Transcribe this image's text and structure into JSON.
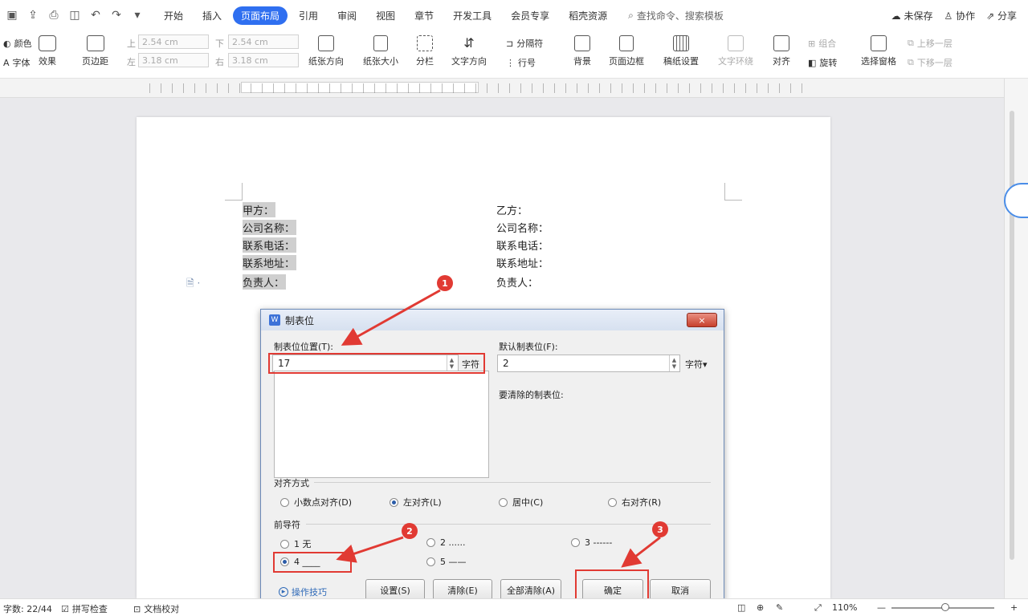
{
  "quick_access": [
    "save-icon",
    "export-icon",
    "print-icon",
    "preview-icon",
    "undo-icon",
    "redo-icon",
    "more-icon"
  ],
  "menu": {
    "tabs": [
      "开始",
      "插入",
      "页面布局",
      "引用",
      "审阅",
      "视图",
      "章节",
      "开发工具",
      "会员专享",
      "稻壳资源"
    ],
    "active_tab": "页面布局",
    "search": "查找命令、搜索模板"
  },
  "top_right": {
    "save_status": "未保存",
    "collab": "协作",
    "share": "分享"
  },
  "ribbon": {
    "color": "颜色",
    "font": "字体",
    "effects": "效果",
    "margins": "页边距",
    "top_label": "上",
    "top_value": "2.54 cm",
    "bottom_label": "下",
    "bottom_value": "2.54 cm",
    "left_label": "左",
    "left_value": "3.18 cm",
    "right_label": "右",
    "right_value": "3.18 cm",
    "orientation": "纸张方向",
    "size": "纸张大小",
    "columns": "分栏",
    "text_direction": "文字方向",
    "breaks": "分隔符",
    "line_numbers": "行号",
    "background": "背景",
    "page_border": "页面边框",
    "paper_setup": "稿纸设置",
    "text_wrap": "文字环绕",
    "align": "对齐",
    "group": "组合",
    "rotate": "旋转",
    "selection_pane": "选择窗格",
    "bring_forward": "上移一层",
    "send_backward": "下移一层"
  },
  "document": {
    "left": [
      "甲方：",
      "公司名称：",
      "联系电话：",
      "联系地址：",
      "负责人："
    ],
    "right": [
      "乙方：",
      "公司名称：",
      "联系电话：",
      "联系地址：",
      "负责人："
    ]
  },
  "dialog": {
    "title": "制表位",
    "close": "×",
    "tab_position_label": "制表位位置(T):",
    "tab_position_value": "17",
    "tab_position_unit": "字符",
    "default_tab_label": "默认制表位(F):",
    "default_tab_value": "2",
    "default_tab_unit": "字符▾",
    "to_clear_label": "要清除的制表位:",
    "alignment_title": "对齐方式",
    "alignment_options": [
      "小数点对齐(D)",
      "左对齐(L)",
      "居中(C)",
      "右对齐(R)"
    ],
    "alignment_selected": "左对齐(L)",
    "leader_title": "前导符",
    "leader_options": [
      "1 无",
      "2 ......",
      "3 ------",
      "4 ____",
      "5 ——"
    ],
    "leader_selected": "4 ____",
    "tips": "操作技巧",
    "buttons": {
      "set": "设置(S)",
      "clear": "清除(E)",
      "clear_all": "全部清除(A)",
      "ok": "确定",
      "cancel": "取消"
    }
  },
  "annotations": [
    "1",
    "2",
    "3"
  ],
  "status_bar": {
    "word_count": "字数: 22/44",
    "spell_check": "拼写检查",
    "doc_proof": "文档校对",
    "zoom": "110%"
  },
  "colors": {
    "accent": "#2f6ff0",
    "annotation_red": "#e13a33"
  }
}
